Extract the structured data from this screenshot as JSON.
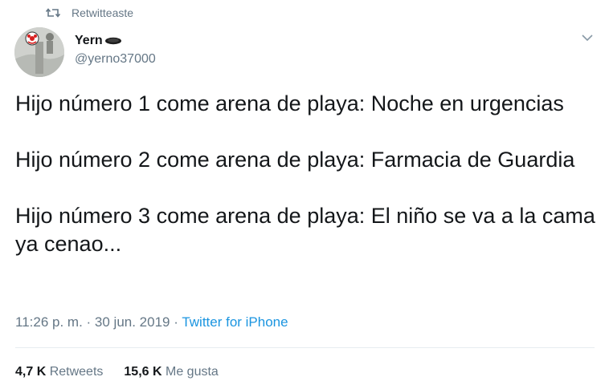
{
  "retweet": {
    "icon": "retweet-icon",
    "label": "Retwitteaste"
  },
  "author": {
    "avatar": "avatar",
    "name": "Yern",
    "name_emoji": "manhole-emoji",
    "handle": "@yerno37000"
  },
  "menu": {
    "icon": "chevron-down-icon"
  },
  "tweet": {
    "paragraphs": [
      "Hijo número 1 come arena de playa: Noche en urgencias",
      "Hijo número 2 come arena de playa: Farmacia de Guardia",
      "Hijo número 3 come arena de playa: El niño se va a la cama ya cenao..."
    ]
  },
  "meta": {
    "time": "11:26 p. m.",
    "sep1": " · ",
    "date": "30 jun. 2019",
    "sep2": " · ",
    "source": "Twitter for iPhone"
  },
  "stats": {
    "retweets_count": "4,7 K",
    "retweets_label": "Retweets",
    "likes_count": "15,6 K",
    "likes_label": "Me gusta"
  },
  "colors": {
    "text": "#14171a",
    "secondary": "#657786",
    "link": "#1b95e0",
    "divider": "#e6ecf0"
  }
}
